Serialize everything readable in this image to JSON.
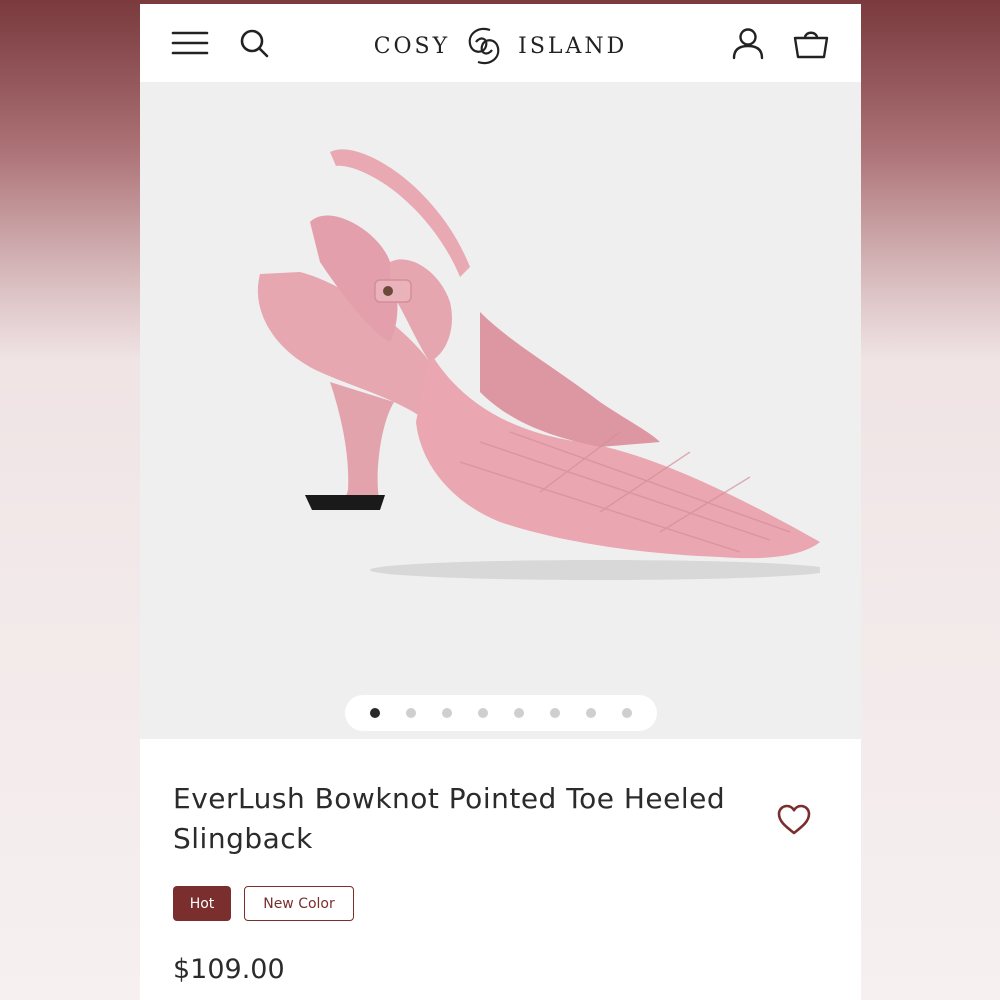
{
  "header": {
    "logo_left": "COSY",
    "logo_right": "ISLAND",
    "icons": [
      "menu-icon",
      "search-icon",
      "account-icon",
      "basket-icon"
    ]
  },
  "gallery": {
    "image_count": 8,
    "active_index": 0
  },
  "product": {
    "title": "EverLush Bowknot Pointed Toe Heeled Slingback",
    "badges": {
      "hot": "Hot",
      "new": "New Color"
    },
    "price": "$109.00"
  },
  "colors": {
    "accent": "#7a2e2e",
    "shoe_pink": "#e8aab4",
    "background": "#efefef"
  }
}
